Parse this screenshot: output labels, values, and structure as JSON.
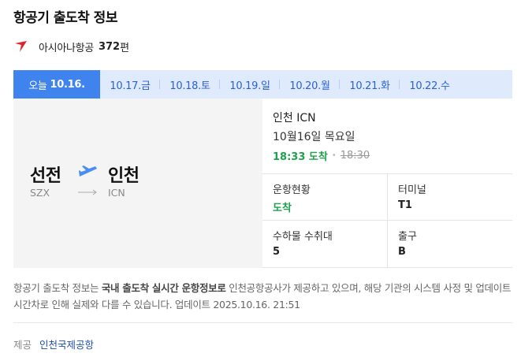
{
  "header": {
    "title": "항공기 출도착 정보"
  },
  "flight": {
    "airline": "아시아나항공",
    "number": "372",
    "number_suffix": "편",
    "brand_color": "#e0222b"
  },
  "dates": {
    "active_prefix": "오늘",
    "active_date": "10.16.",
    "tabs": [
      "10.17.금",
      "10.18.토",
      "10.19.일",
      "10.20.월",
      "10.21.화",
      "10.22.수"
    ]
  },
  "route": {
    "from_city": "선전",
    "from_code": "SZX",
    "to_city": "인천",
    "to_code": "ICN"
  },
  "arrival": {
    "city": "인천 ICN",
    "date": "10월16일 목요일",
    "actual": "18:33 도착",
    "scheduled": "18:30"
  },
  "details": {
    "status_label": "운항현황",
    "status_value": "도착",
    "terminal_label": "터미널",
    "terminal_value": "T1",
    "baggage_label": "수하물 수취대",
    "baggage_value": "5",
    "exit_label": "출구",
    "exit_value": "B"
  },
  "notice": {
    "part1": "항공기 출도착 정보는 ",
    "bold": "국내 출도착 실시간 운항정보로",
    "part2": " 인천공항공사가 제공하고 있으며, 해당 기관의 시스템 사정 및 업데이트 시간차로 인해 실제와 다를 수 있습니다. 업데이트 2025.10.16. 21:51"
  },
  "provider": {
    "label": "제공",
    "name": "인천국제공항"
  },
  "colors": {
    "accent": "#3f83ee",
    "tab_bg": "#dfeafc",
    "arrived": "#1ea14c",
    "plane": "#4a8ef5"
  }
}
